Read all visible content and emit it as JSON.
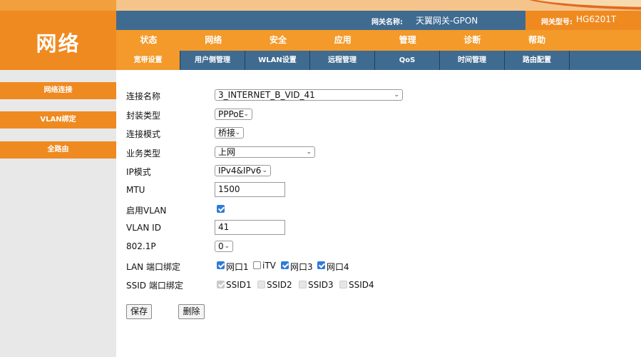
{
  "brand": {
    "logo_text": "网络"
  },
  "info_bar": {
    "gateway_name_label": "网关名称:",
    "gateway_name_value": "天翼网关-GPON",
    "model_label": "网关型号:",
    "model_value": "HG6201T"
  },
  "main_nav": [
    "状态",
    "网络",
    "安全",
    "应用",
    "管理",
    "诊断",
    "帮助"
  ],
  "sub_nav": [
    "宽带设置",
    "用户侧管理",
    "WLAN设置",
    "远程管理",
    "QoS",
    "时间管理",
    "路由配置"
  ],
  "sidebar": [
    "网络连接",
    "VLAN绑定",
    "全路由"
  ],
  "form": {
    "connection_name": {
      "label": "连接名称",
      "value": "3_INTERNET_B_VID_41"
    },
    "encapsulation": {
      "label": "封装类型",
      "value": "PPPoE"
    },
    "connection_mode": {
      "label": "连接模式",
      "value": "桥接"
    },
    "service_type": {
      "label": "业务类型",
      "value": "上网"
    },
    "ip_mode": {
      "label": "IP模式",
      "value": "IPv4&IPv6"
    },
    "mtu": {
      "label": "MTU",
      "value": "1500"
    },
    "enable_vlan": {
      "label": "启用VLAN",
      "checked": true
    },
    "vlan_id": {
      "label": "VLAN ID",
      "value": "41"
    },
    "priority": {
      "label": "802.1P",
      "value": "0"
    },
    "lan_binding": {
      "label": "LAN 端口绑定",
      "options": [
        {
          "label": "网口1",
          "checked": true
        },
        {
          "label": "iTV",
          "checked": false
        },
        {
          "label": "网口3",
          "checked": true
        },
        {
          "label": "网口4",
          "checked": true
        }
      ]
    },
    "ssid_binding": {
      "label": "SSID 端口绑定",
      "options": [
        {
          "label": "SSID1",
          "checked": true
        },
        {
          "label": "SSID2",
          "checked": false
        },
        {
          "label": "SSID3",
          "checked": false
        },
        {
          "label": "SSID4",
          "checked": false
        }
      ]
    },
    "save_label": "保存",
    "delete_label": "删除"
  },
  "colors": {
    "orange": "#ef8a20",
    "nav_orange": "#f39a2a",
    "blue": "#3f6b91",
    "sidebar_bg": "#e8e8e8",
    "checkbox_blue": "#2f7bd8"
  }
}
